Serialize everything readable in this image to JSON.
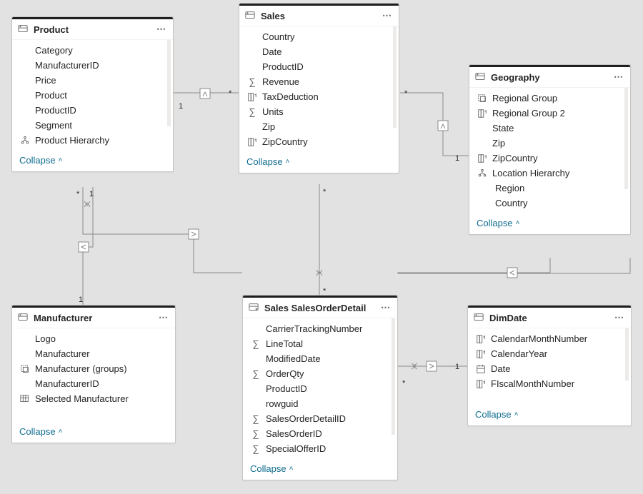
{
  "collapse_label": "Collapse",
  "tables": {
    "product": {
      "title": "Product",
      "fields": [
        {
          "icon": "",
          "label": "Category"
        },
        {
          "icon": "",
          "label": "ManufacturerID"
        },
        {
          "icon": "",
          "label": "Price"
        },
        {
          "icon": "",
          "label": "Product"
        },
        {
          "icon": "",
          "label": "ProductID"
        },
        {
          "icon": "",
          "label": "Segment"
        },
        {
          "icon": "hierarchy",
          "label": "Product Hierarchy"
        }
      ]
    },
    "sales": {
      "title": "Sales",
      "fields": [
        {
          "icon": "",
          "label": "Country"
        },
        {
          "icon": "",
          "label": "Date"
        },
        {
          "icon": "",
          "label": "ProductID"
        },
        {
          "icon": "sigma",
          "label": "Revenue"
        },
        {
          "icon": "calc",
          "label": "TaxDeduction"
        },
        {
          "icon": "sigma",
          "label": "Units"
        },
        {
          "icon": "",
          "label": "Zip"
        },
        {
          "icon": "calc",
          "label": "ZipCountry"
        }
      ]
    },
    "geography": {
      "title": "Geography",
      "fields": [
        {
          "icon": "group",
          "label": "Regional Group"
        },
        {
          "icon": "calc",
          "label": "Regional Group 2"
        },
        {
          "icon": "",
          "label": "State"
        },
        {
          "icon": "",
          "label": "Zip"
        },
        {
          "icon": "calc",
          "label": "ZipCountry"
        },
        {
          "icon": "hierarchy",
          "label": "Location Hierarchy"
        },
        {
          "icon": "indent",
          "label": "Region"
        },
        {
          "icon": "indent",
          "label": "Country"
        }
      ]
    },
    "manufacturer": {
      "title": "Manufacturer",
      "fields": [
        {
          "icon": "",
          "label": "Logo"
        },
        {
          "icon": "",
          "label": "Manufacturer"
        },
        {
          "icon": "group",
          "label": "Manufacturer (groups)"
        },
        {
          "icon": "",
          "label": "ManufacturerID"
        },
        {
          "icon": "table",
          "label": "Selected Manufacturer"
        }
      ]
    },
    "salesorderdetail": {
      "title": "Sales SalesOrderDetail",
      "fields": [
        {
          "icon": "",
          "label": "CarrierTrackingNumber"
        },
        {
          "icon": "sigma",
          "label": "LineTotal"
        },
        {
          "icon": "",
          "label": "ModifiedDate"
        },
        {
          "icon": "sigma",
          "label": "OrderQty"
        },
        {
          "icon": "",
          "label": "ProductID"
        },
        {
          "icon": "",
          "label": "rowguid"
        },
        {
          "icon": "sigma",
          "label": "SalesOrderDetailID"
        },
        {
          "icon": "sigma",
          "label": "SalesOrderID"
        },
        {
          "icon": "sigma",
          "label": "SpecialOfferID"
        }
      ]
    },
    "dimdate": {
      "title": "DimDate",
      "fields": [
        {
          "icon": "calc",
          "label": "CalendarMonthNumber"
        },
        {
          "icon": "calc",
          "label": "CalendarYear"
        },
        {
          "icon": "date",
          "label": "Date"
        },
        {
          "icon": "calc",
          "label": "FIscalMonthNumber"
        }
      ]
    }
  },
  "relationships": [
    {
      "from": "Sales",
      "to": "Product",
      "from_card": "*",
      "to_card": "1"
    },
    {
      "from": "Sales",
      "to": "Geography",
      "from_card": "*",
      "to_card": "1"
    },
    {
      "from": "Product",
      "to": "Manufacturer",
      "from_card": "*",
      "to_card": "1"
    },
    {
      "from": "Sales SalesOrderDetail",
      "to": "Sales",
      "from_card": "*",
      "to_card": "*"
    },
    {
      "from": "Sales SalesOrderDetail",
      "to": "Product",
      "from_card": "*",
      "to_card": "1"
    },
    {
      "from": "Sales SalesOrderDetail",
      "to": "Geography",
      "from_card": "*",
      "to_card": "1"
    },
    {
      "from": "Sales SalesOrderDetail",
      "to": "DimDate",
      "from_card": "*",
      "to_card": "1"
    }
  ]
}
